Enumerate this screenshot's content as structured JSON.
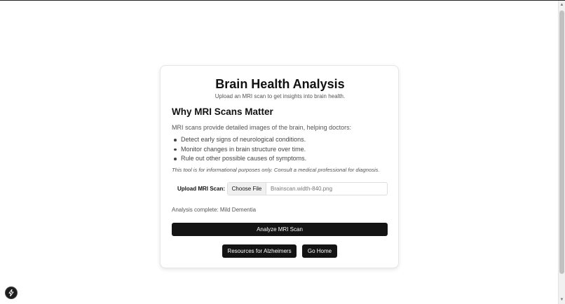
{
  "card": {
    "title": "Brain Health Analysis",
    "subtitle": "Upload an MRI scan to get insights into brain health.",
    "section_heading": "Why MRI Scans Matter",
    "intro": "MRI scans provide detailed images of the brain, helping doctors:",
    "bullets": [
      "Detect early signs of neurological conditions.",
      "Monitor changes in brain structure over time.",
      "Rule out other possible causes of symptoms."
    ],
    "disclaimer": "This tool is for informational purposes only. Consult a medical professional for diagnosis."
  },
  "upload": {
    "label": "Upload MRI Scan:",
    "choose_button": "Choose File",
    "file_name": "Brainscan.width-840.png"
  },
  "status": "Analysis complete: Mild Dementia",
  "buttons": {
    "analyze": "Analyze MRI Scan",
    "resources": "Resources for Alzheimers",
    "home": "Go Home"
  },
  "icons": {
    "fab": "lightning-icon"
  },
  "colors": {
    "button_bg": "#141414",
    "button_text": "#ffffff"
  }
}
